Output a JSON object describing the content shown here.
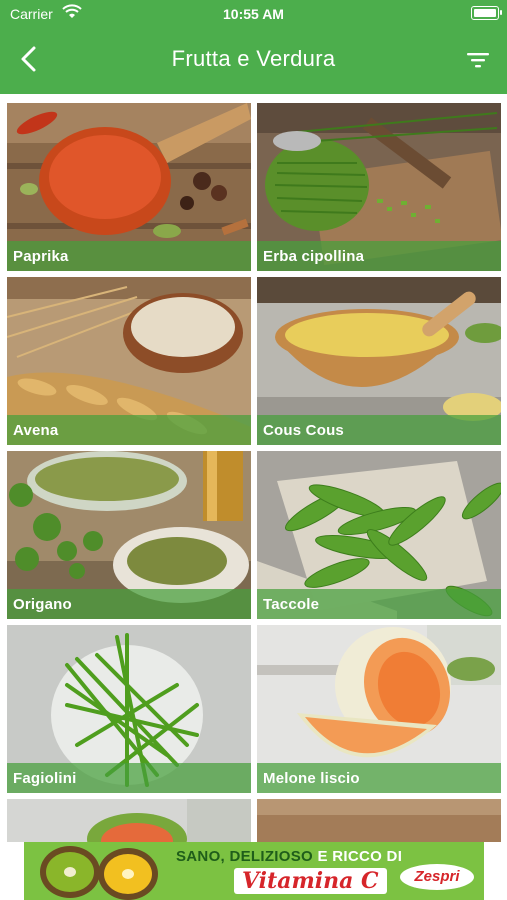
{
  "status_bar": {
    "carrier": "Carrier",
    "time": "10:55 AM"
  },
  "header": {
    "title": "Frutta e Verdura",
    "back_icon": "chevron-left-icon",
    "filter_icon": "filter-icon"
  },
  "theme": {
    "primary": "#4cae4c",
    "label_bar": "#46a03c"
  },
  "products": [
    {
      "name": "Paprika"
    },
    {
      "name": "Erba cipollina"
    },
    {
      "name": "Avena"
    },
    {
      "name": "Cous Cous"
    },
    {
      "name": "Origano"
    },
    {
      "name": "Taccole"
    },
    {
      "name": "Fagiolini"
    },
    {
      "name": "Melone liscio"
    }
  ],
  "ad_banner": {
    "line1_prefix": "SANO, DELIZIOSO",
    "line1_highlight": "E RICCO DI",
    "line2": "Vitamina C",
    "brand": "Zespri"
  }
}
